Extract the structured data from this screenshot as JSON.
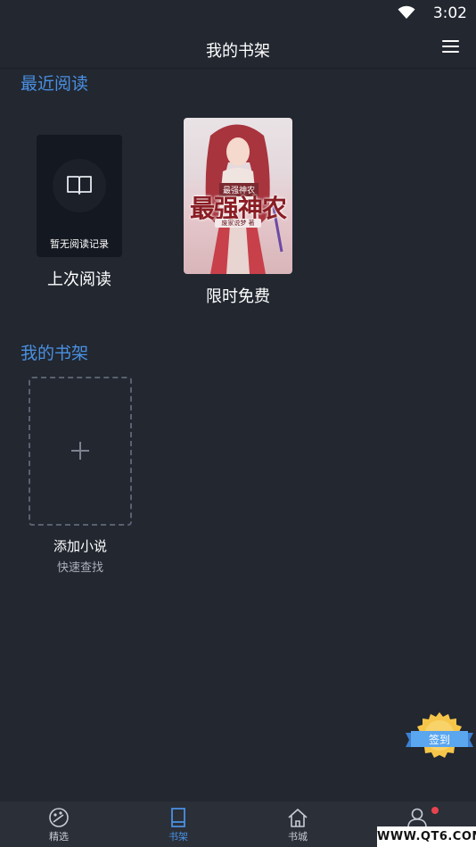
{
  "status_bar": {
    "time": "3:02",
    "icon": "wifi-icon"
  },
  "header": {
    "title": "我的书架",
    "menu_icon": "hamburger-menu-icon"
  },
  "recent": {
    "section_title": "最近阅读",
    "empty_card_text": "暂无阅读记录",
    "empty_card_label": "上次阅读",
    "book_cover_title": "最强神农",
    "book_cover_small_title": "最强神农",
    "book_cover_author": "废家说梦 著",
    "book_label": "限时免费"
  },
  "shelf": {
    "section_title": "我的书架",
    "add_title": "添加小说",
    "add_subtitle": "快速查找"
  },
  "checkin": {
    "label": "签到"
  },
  "nav": {
    "items": [
      {
        "label": "精选",
        "icon": "palette-icon",
        "active": false
      },
      {
        "label": "书架",
        "icon": "bookshelf-icon",
        "active": true
      },
      {
        "label": "书城",
        "icon": "home-icon",
        "active": false
      },
      {
        "label": "",
        "icon": "user-icon",
        "active": false
      }
    ]
  },
  "watermark": "WWW.QT6.COM",
  "colors": {
    "background": "#222730",
    "accent": "#4a90e2",
    "badge_dot": "#e8434f",
    "checkin_seal": "#f6c64a"
  }
}
